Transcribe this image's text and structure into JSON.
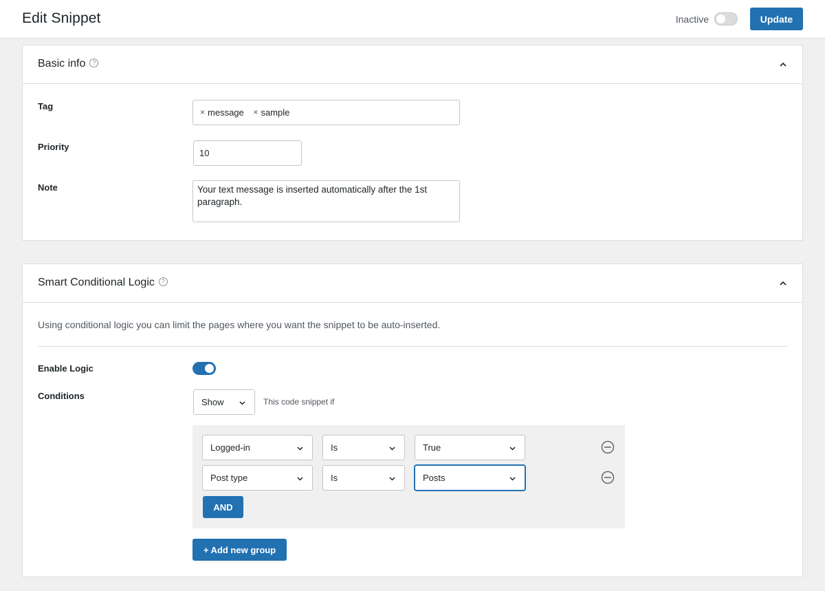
{
  "header": {
    "title": "Edit Snippet",
    "status_label": "Inactive",
    "update_label": "Update"
  },
  "basic_info": {
    "title": "Basic info",
    "tag_label": "Tag",
    "tags": [
      "message",
      "sample"
    ],
    "priority_label": "Priority",
    "priority_value": "10",
    "note_label": "Note",
    "note_value": "Your text message is inserted automatically after the 1st paragraph."
  },
  "logic": {
    "title": "Smart Conditional Logic",
    "intro": "Using conditional logic you can limit the pages where you want the snippet to be auto-inserted.",
    "enable_label": "Enable Logic",
    "enabled": true,
    "conditions_label": "Conditions",
    "show_value": "Show",
    "hint": "This code snippet if",
    "rules": [
      {
        "field": "Logged-in",
        "operator": "Is",
        "value": "True"
      },
      {
        "field": "Post type",
        "operator": "Is",
        "value": "Posts"
      }
    ],
    "and_label": "AND",
    "add_group_label": "+ Add new group"
  },
  "colors": {
    "primary": "#2271b1",
    "background": "#f0f0f1",
    "border": "#dcdcde"
  }
}
